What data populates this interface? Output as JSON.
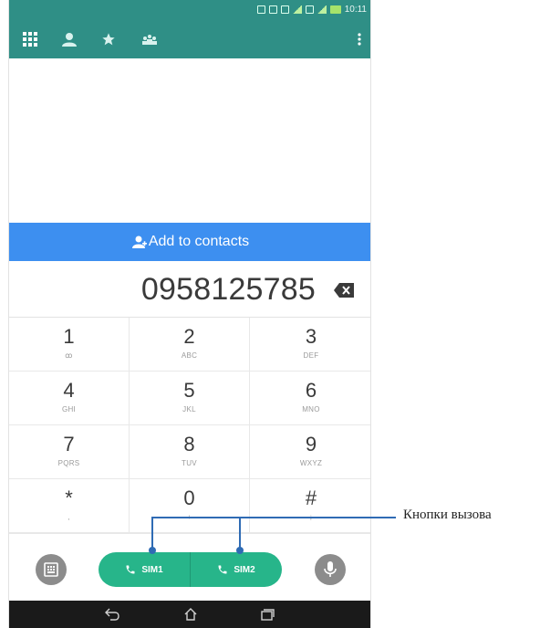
{
  "status_bar": {
    "time": "10:11"
  },
  "toolbar": {
    "tabs": [
      {
        "name": "dialpad",
        "icon": "grid-icon",
        "active": true
      },
      {
        "name": "contacts",
        "icon": "person-icon",
        "active": false
      },
      {
        "name": "favorites",
        "icon": "star-icon",
        "active": false
      },
      {
        "name": "groups",
        "icon": "group-icon",
        "active": false
      }
    ],
    "overflow_icon": "more-vert-icon"
  },
  "add_contacts": {
    "label": "Add to contacts",
    "icon": "add-person-icon"
  },
  "dialer": {
    "number": "0958125785",
    "backspace_icon": "backspace-icon"
  },
  "keypad": [
    {
      "digit": "1",
      "letters": "ꝏ"
    },
    {
      "digit": "2",
      "letters": "ABC"
    },
    {
      "digit": "3",
      "letters": "DEF"
    },
    {
      "digit": "4",
      "letters": "GHI"
    },
    {
      "digit": "5",
      "letters": "JKL"
    },
    {
      "digit": "6",
      "letters": "MNO"
    },
    {
      "digit": "7",
      "letters": "PQRS"
    },
    {
      "digit": "8",
      "letters": "TUV"
    },
    {
      "digit": "9",
      "letters": "WXYZ"
    },
    {
      "digit": "*",
      "letters": ","
    },
    {
      "digit": "0",
      "letters": "+"
    },
    {
      "digit": "#",
      "letters": ";"
    }
  ],
  "actions": {
    "sim1_label": "SIM1",
    "sim2_label": "SIM2",
    "call_color": "#27b58a"
  },
  "callout": {
    "label": "Кнопки вызова"
  },
  "colors": {
    "toolbar": "#2f8f86",
    "add_bar": "#3d8ff0",
    "callout": "#2f6bb4"
  }
}
